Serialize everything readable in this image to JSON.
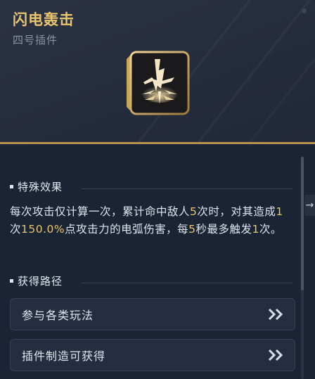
{
  "header": {
    "title": "闪电轰击",
    "subtitle": "四号插件",
    "icon": "lightning-strike-icon"
  },
  "effect": {
    "title": "特殊效果",
    "parts": [
      "每次攻击仅计算一次，累计命中敌人",
      "5",
      "次时，对其造成",
      "1",
      "次",
      "150.0%",
      "点攻击力的电弧伤害，每",
      "5",
      "秒最多触发",
      "1",
      "次。"
    ]
  },
  "acquire": {
    "title": "获得路径",
    "items": [
      {
        "label": "参与各类玩法"
      },
      {
        "label": "插件制造可获得"
      }
    ]
  },
  "colors": {
    "accent": "#e8c56e",
    "background": "#1b2434",
    "header": "#252c3b"
  }
}
